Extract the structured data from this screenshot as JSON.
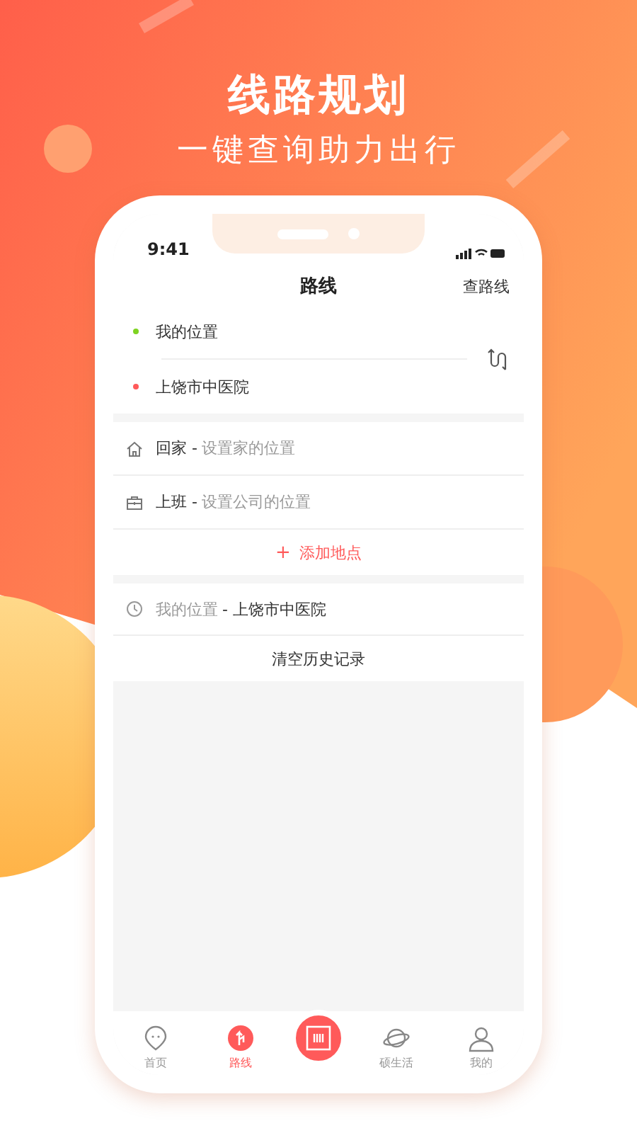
{
  "promo": {
    "title": "线路规划",
    "subtitle": "一键查询助力出行"
  },
  "status_bar": {
    "time": "9:41"
  },
  "nav": {
    "title": "路线",
    "action": "查路线"
  },
  "route": [
    {
      "label": "我的位置",
      "color": "#7ed321"
    },
    {
      "label": "上饶市中医院",
      "color": "#ff5a5a"
    }
  ],
  "places": [
    {
      "kind": "home",
      "name": "回家 -",
      "hint": "设置家的位置"
    },
    {
      "kind": "work",
      "name": "上班 -",
      "hint": "设置公司的位置"
    }
  ],
  "add_place": {
    "icon": "+",
    "label": "添加地点"
  },
  "history": [
    {
      "from": "我的位置",
      "to": "- 上饶市中医院"
    }
  ],
  "clear_history": "清空历史记录",
  "tabs": [
    {
      "kind": "home",
      "label": "首页",
      "selected": false
    },
    {
      "kind": "route",
      "label": "路线",
      "selected": true
    },
    {
      "kind": "scan",
      "selected": false
    },
    {
      "kind": "planet",
      "label": "硕生活",
      "selected": false
    },
    {
      "kind": "user",
      "label": "我的",
      "selected": false
    }
  ]
}
